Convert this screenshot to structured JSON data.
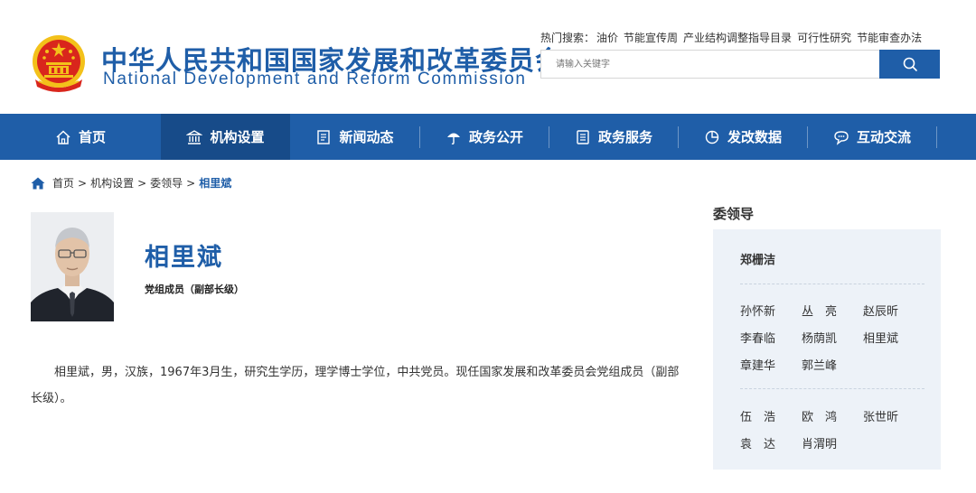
{
  "header": {
    "title_cn": "中华人民共和国国家发展和改革委员会",
    "title_en": "National Development and Reform Commission",
    "hot_label": "热门搜索：",
    "hot_terms": [
      "油价",
      "节能宣传周",
      "产业结构调整指导目录",
      "可行性研究",
      "节能审查办法"
    ],
    "search_placeholder": "请输入关键字"
  },
  "nav": [
    {
      "label": "首页",
      "icon": "home-icon"
    },
    {
      "label": "机构设置",
      "icon": "building-icon",
      "active": true
    },
    {
      "label": "新闻动态",
      "icon": "news-icon"
    },
    {
      "label": "政务公开",
      "icon": "umbrella-icon"
    },
    {
      "label": "政务服务",
      "icon": "document-icon"
    },
    {
      "label": "发改数据",
      "icon": "pie-chart-icon"
    },
    {
      "label": "互动交流",
      "icon": "chat-icon"
    }
  ],
  "breadcrumb": {
    "items": [
      "首页",
      "机构设置",
      "委领导"
    ],
    "separator": ">",
    "current": "相里斌"
  },
  "profile": {
    "name": "相里斌",
    "position": "党组成员（副部长级）",
    "bio": "相里斌，男，汉族，1967年3月生，研究生学历，理学博士学位，中共党员。现任国家发展和改革委员会党组成员（副部长级）。"
  },
  "sidebar": {
    "title": "委领导",
    "leaders": [
      "郑栅洁",
      "孙怀新",
      "丛　亮",
      "赵辰昕",
      "李春临",
      "杨荫凯",
      "相里斌",
      "章建华",
      "郭兰峰",
      "伍　浩",
      "欧　鸿",
      "张世昕",
      "袁　达",
      "肖渭明"
    ]
  },
  "colors": {
    "primary": "#1f5ea8",
    "nav_active": "#174b89",
    "sidebar_bg": "#edf2f8",
    "emblem_red": "#d9261c",
    "emblem_gold": "#f3c11a"
  }
}
